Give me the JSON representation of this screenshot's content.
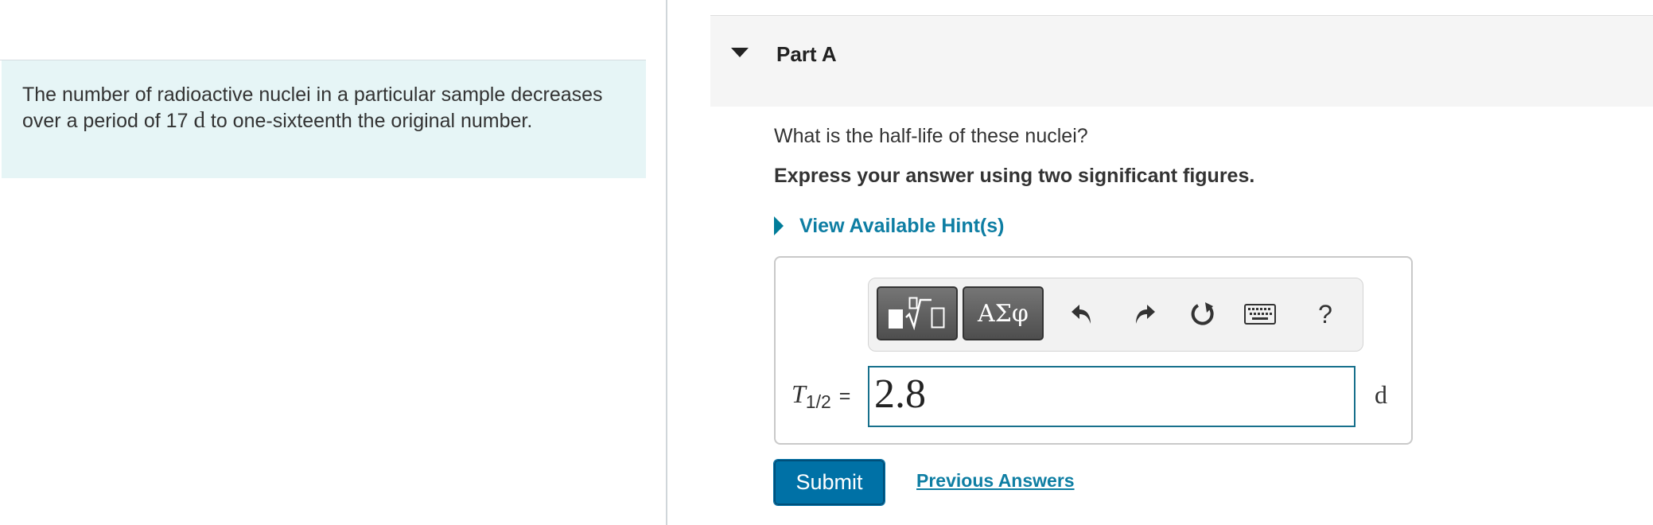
{
  "problem": {
    "text_before": "The number of radioactive nuclei in a particular sample decreases over a period of 17",
    "unit": "d",
    "text_after": "to one-sixteenth the original number."
  },
  "part": {
    "title": "Part A",
    "question": "What is the half-life of these nuclei?",
    "instruction": "Express your answer using two significant figures."
  },
  "hint": {
    "label": "View Available Hint(s)"
  },
  "toolbar": {
    "greek_label": "ΑΣφ",
    "help_label": "?"
  },
  "answer": {
    "variable": "T",
    "subscript": "1/2",
    "equals": "=",
    "value": "2.8",
    "unit": "d"
  },
  "actions": {
    "submit_label": "Submit",
    "previous_answers_label": "Previous Answers"
  },
  "colors": {
    "accent": "#0071a6",
    "link": "#0e7ea3",
    "problem_background": "#e6f5f6"
  }
}
